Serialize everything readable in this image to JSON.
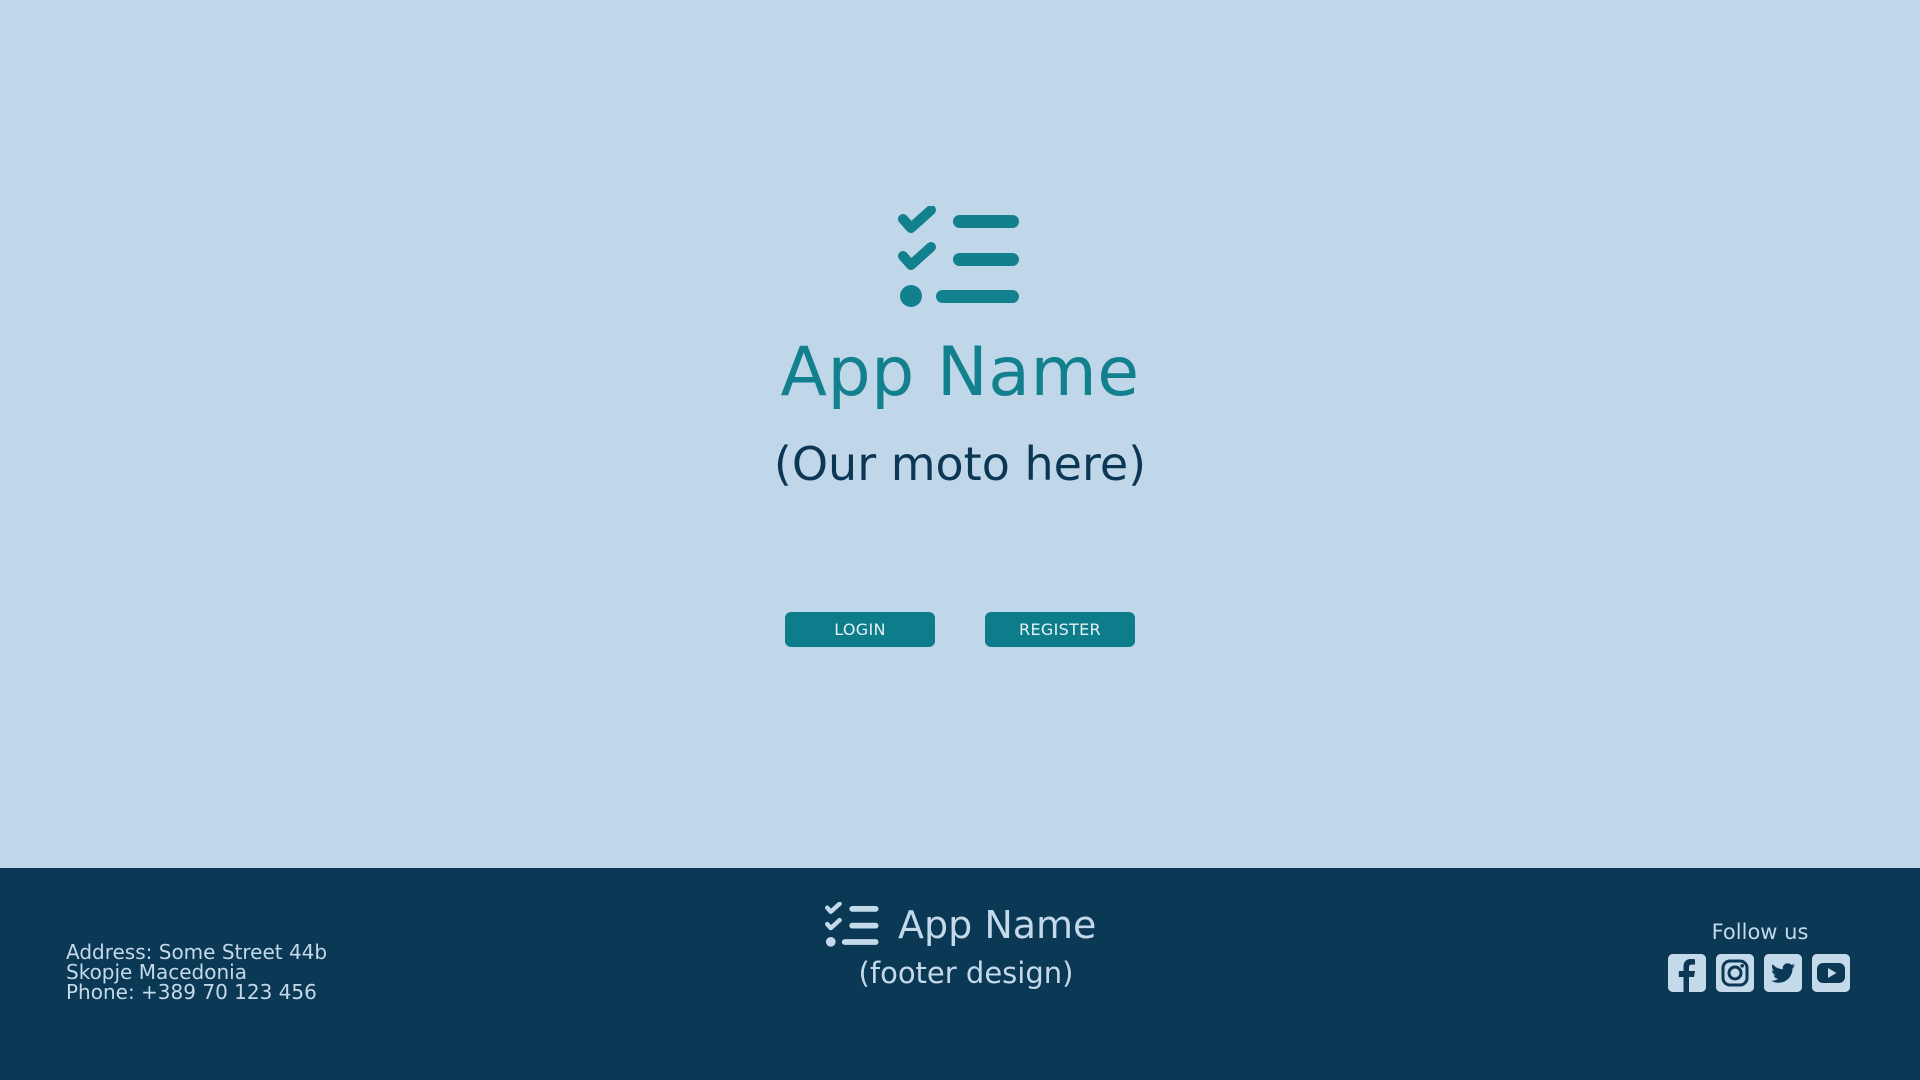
{
  "hero": {
    "logo_icon": "checklist-icon",
    "app_name": "App Name",
    "motto": "(Our moto here)",
    "login_label": "LOGIN",
    "register_label": "REGISTER"
  },
  "footer": {
    "address_lines": [
      "Address: Some Street 44b",
      "Skopje Macedonia",
      "Phone: +389 70 123 456"
    ],
    "logo_icon": "checklist-icon",
    "app_name": "App Name",
    "subtitle": "(footer design)",
    "follow_label": "Follow us",
    "socials": [
      {
        "icon": "facebook-icon"
      },
      {
        "icon": "instagram-icon"
      },
      {
        "icon": "twitter-icon"
      },
      {
        "icon": "youtube-icon"
      }
    ]
  },
  "colors": {
    "background": "#c0d7ea",
    "accent": "#0e7d8b",
    "footer_bg": "#0b3854",
    "footer_text": "#c4d9ea",
    "motto_text": "#0b3754"
  }
}
